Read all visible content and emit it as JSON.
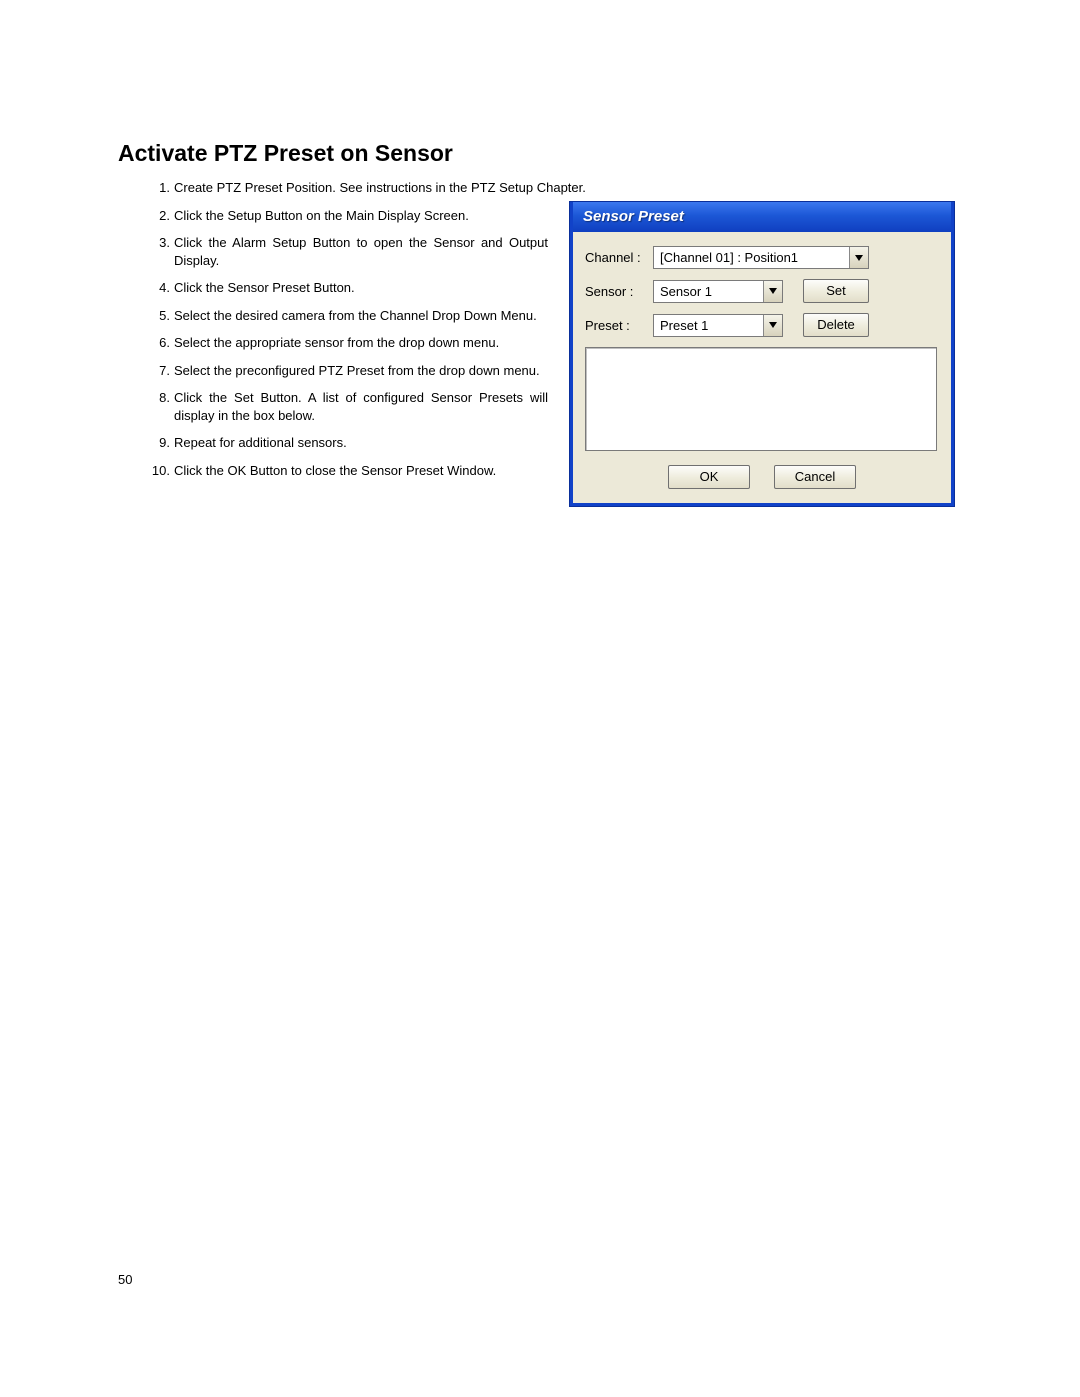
{
  "page": {
    "title": "Activate PTZ Preset on Sensor",
    "page_number": "50"
  },
  "steps": [
    "Create PTZ Preset Position.  See instructions in the PTZ Setup Chapter.",
    "Click the Setup Button on the Main Display Screen.",
    "Click the Alarm Setup Button to open the Sensor and Output Display.",
    "Click the Sensor Preset Button.",
    "Select the desired camera from the Channel Drop Down Menu.",
    "Select the appropriate sensor from the drop down menu.",
    "Select the preconfigured PTZ Preset from the drop down menu.",
    "Click the Set Button.  A list of configured Sensor Presets will display in the box below.",
    "Repeat for additional sensors.",
    "Click the OK Button to close the Sensor Preset Window."
  ],
  "dialog": {
    "title": "Sensor Preset",
    "labels": {
      "channel": "Channel :",
      "sensor": "Sensor :",
      "preset": "Preset :"
    },
    "values": {
      "channel": "[Channel 01] : Position1",
      "sensor": "Sensor 1",
      "preset": "Preset 1"
    },
    "buttons": {
      "set": "Set",
      "delete": "Delete",
      "ok": "OK",
      "cancel": "Cancel"
    }
  }
}
